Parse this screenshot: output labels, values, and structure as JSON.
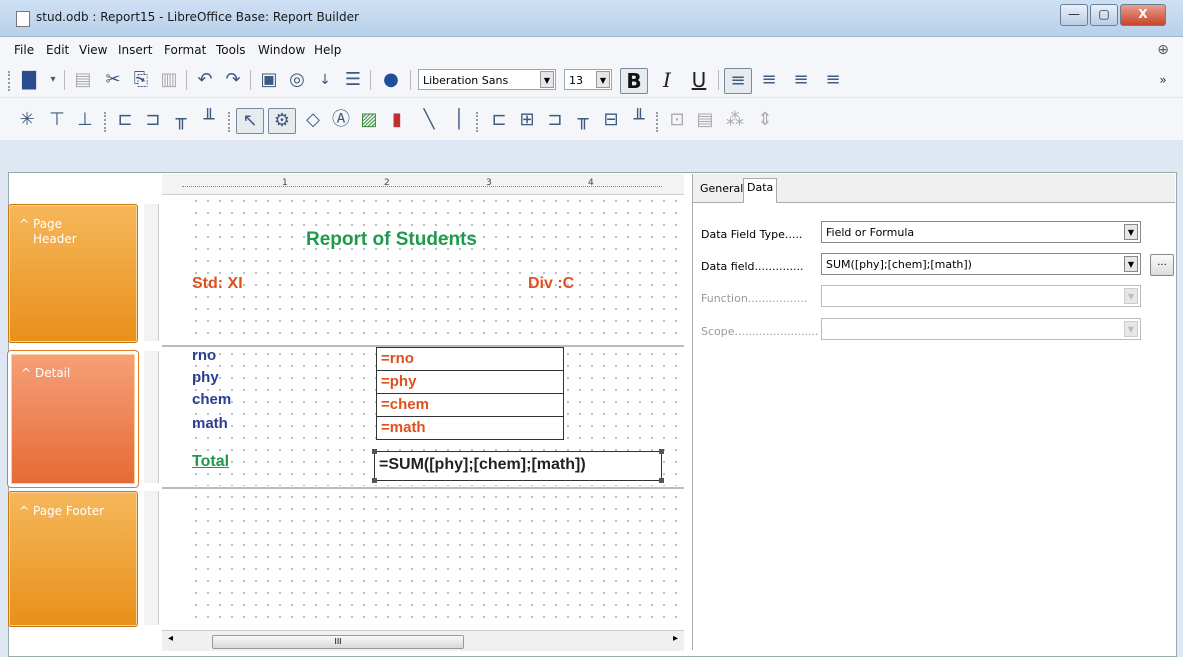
{
  "window": {
    "title": "stud.odb : Report15 - LibreOffice Base: Report Builder",
    "controls": {
      "minimize": "—",
      "maximize": "▢",
      "close": "X"
    }
  },
  "menu": [
    "File",
    "Edit",
    "View",
    "Insert",
    "Format",
    "Tools",
    "Window",
    "Help"
  ],
  "toolbar1": {
    "font_name": "Liberation Sans",
    "font_size": "13",
    "bold": "B",
    "italic": "I",
    "underline": "U",
    "overflow": "»"
  },
  "sections": {
    "page_header": "Page Header",
    "detail": "Detail",
    "page_footer": "Page Footer"
  },
  "ruler": {
    "marks": [
      "1",
      "2",
      "3",
      "4"
    ]
  },
  "report": {
    "title": "Report of Students",
    "std": "Std: XI",
    "div": "Div :C",
    "detail_labels": [
      "rno",
      "phy",
      "chem",
      "math"
    ],
    "detail_fields": [
      "=rno",
      "=phy",
      "=chem",
      "=math"
    ],
    "total_label": "Total",
    "total_formula": "=SUM([phy];[chem];[math])"
  },
  "scrollbar": {
    "thumb_label": "III"
  },
  "properties": {
    "tabs": [
      "General",
      "Data"
    ],
    "active_tab": "Data",
    "rows": [
      {
        "label": "Data Field Type.....",
        "value": "Field or Formula",
        "enabled": true
      },
      {
        "label": "Data field..............",
        "value": "SUM([phy];[chem];[math])",
        "enabled": true
      },
      {
        "label": "Function.................",
        "value": "",
        "enabled": false
      },
      {
        "label": "Scope........................",
        "value": "",
        "enabled": false
      }
    ],
    "more_button": "..."
  },
  "colors": {
    "title_green": "#1e9a4a",
    "std_orange": "#e0501e",
    "label_blue": "#2c3e8f",
    "field_orange": "#e0501e",
    "section_orange": "#f0a030"
  }
}
